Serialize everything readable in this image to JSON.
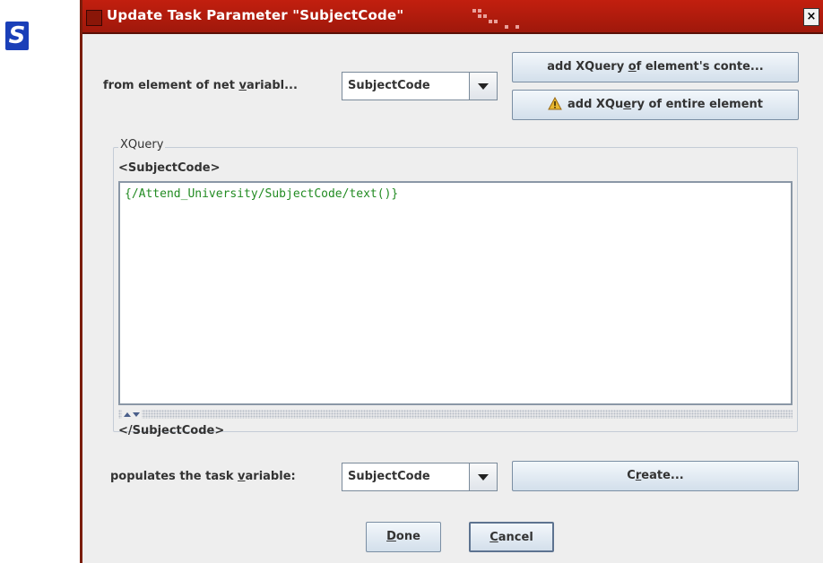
{
  "dialog": {
    "title": "Update Task Parameter \"SubjectCode\"",
    "close_glyph": "×"
  },
  "source": {
    "label_pre": "from element of net ",
    "label_mnemonic": "v",
    "label_post": "ariabl...",
    "selected_value": "SubjectCode"
  },
  "buttons": {
    "add_content_pre": "add XQuery ",
    "add_content_mnemonic": "o",
    "add_content_post": "f element's conte...",
    "add_element_pre": "add XQu",
    "add_element_mnemonic": "e",
    "add_element_post": "ry of entire element",
    "create_pre": "C",
    "create_mnemonic": "r",
    "create_post": "eate...",
    "done_mnemonic": "D",
    "done_post": "one",
    "cancel_mnemonic": "C",
    "cancel_post": "ancel"
  },
  "xquery": {
    "legend": "XQuery",
    "open_tag": "<SubjectCode>",
    "expression": "{/Attend_University/SubjectCode/text()}",
    "close_tag": "</SubjectCode>"
  },
  "target": {
    "label_pre": "populates the task ",
    "label_mnemonic": "v",
    "label_post": "ariable:",
    "selected_value": "SubjectCode"
  },
  "icons": {
    "app_logo": "s-logo-icon",
    "warning": "warning-icon",
    "close": "close-icon",
    "dropdown": "chevron-down-icon"
  },
  "colors": {
    "titlebar": "#b01c0d",
    "xquery_text": "#228b22",
    "button_face": "#dbe5ef"
  }
}
